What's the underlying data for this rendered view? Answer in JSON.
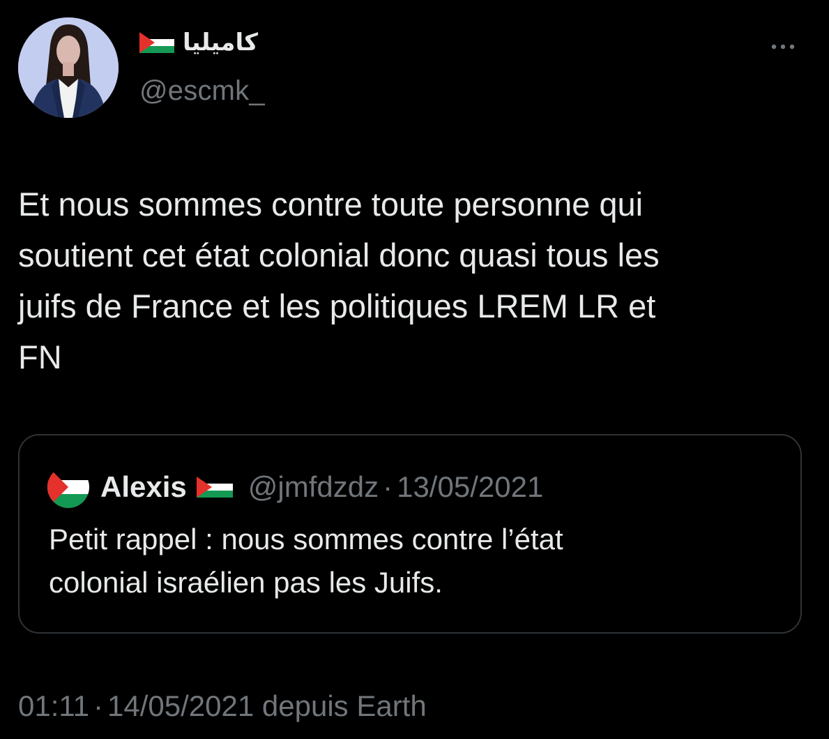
{
  "author": {
    "display_name": "كاميليا",
    "flag_icon": "palestine-flag-icon",
    "handle": "@escmk_",
    "avatar_icon": "illustrated-woman-avatar"
  },
  "menu": {
    "more_icon": "ellipsis-icon",
    "more_label": "···"
  },
  "tweet": {
    "text": "Et nous sommes contre toute personne qui\nsoutient cet état colonial donc quasi tous les\njuifs de France et les politiques LREM LR et\nFN"
  },
  "quoted_tweet": {
    "avatar_icon": "palestine-flag-avatar",
    "name": "Alexis",
    "flag_icon": "palestine-flag-icon",
    "handle": "@jmfdzdz",
    "separator": "·",
    "date": "13/05/2021",
    "text": "Petit rappel : nous sommes contre l’état\ncolonial israélien pas les Juifs."
  },
  "meta": {
    "time": "01:11",
    "separator": "·",
    "date": "14/05/2021",
    "source": "depuis Earth"
  },
  "colors": {
    "background": "#000000",
    "primary_text": "#e7e9ea",
    "secondary_text": "#71767b",
    "border": "#2f3336",
    "flag_red": "#e4312b",
    "flag_green": "#149954",
    "flag_black": "#000000",
    "flag_white": "#ffffff"
  }
}
